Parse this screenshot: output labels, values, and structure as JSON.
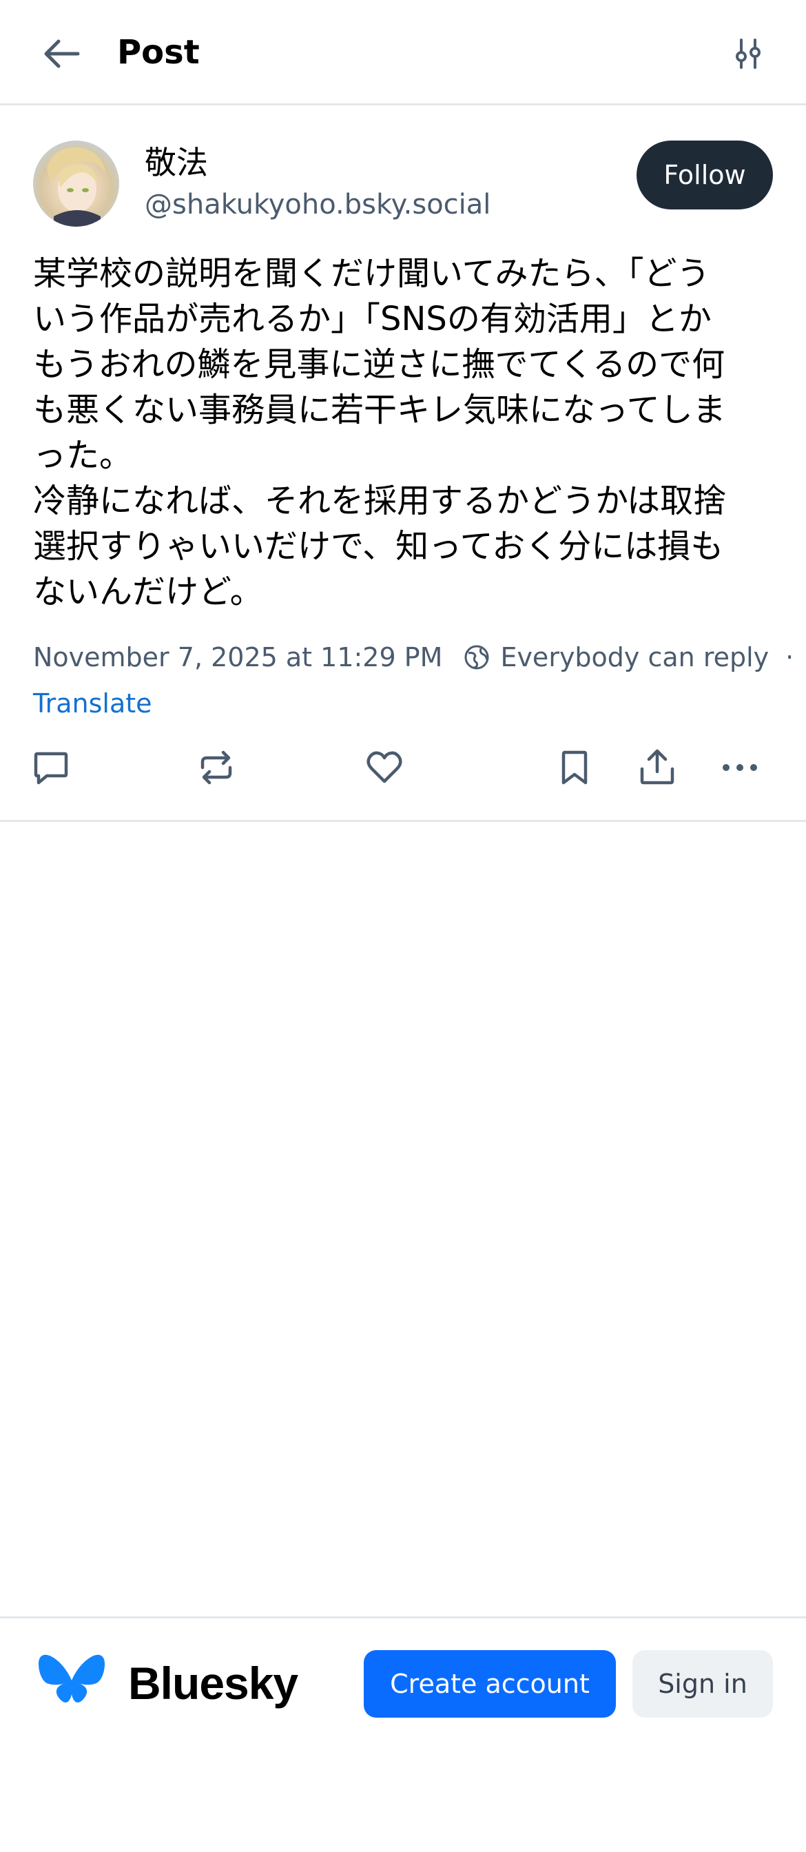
{
  "header": {
    "title": "Post"
  },
  "post": {
    "author": {
      "display_name": "敬法",
      "handle": "@shakukyoho.bsky.social"
    },
    "follow_label": "Follow",
    "text": "某学校の説明を聞くだけ聞いてみたら、「どう\nいう作品が売れるか」「SNSの有効活用」とか\nもうおれの鱗を見事に逆さに撫でてくるので何\nも悪くない事務員に若干キレ気味になってしま\nった。\n冷静になれば、それを採用するかどうかは取捨\n選択すりゃいいだけで、知っておく分には損も\nないんだけど。",
    "timestamp": "November 7, 2025 at 11:29 PM",
    "reply_setting": "Everybody can reply",
    "separator": "·",
    "translate_label": "Translate"
  },
  "actions": {
    "reply_icon": "reply-icon",
    "repost_icon": "repost-icon",
    "like_icon": "heart-icon",
    "bookmark_icon": "bookmark-icon",
    "share_icon": "share-icon",
    "more_icon": "more-icon"
  },
  "footer": {
    "brand": "Bluesky",
    "create_account_label": "Create account",
    "sign_in_label": "Sign in"
  },
  "colors": {
    "accent": "#0a6cff",
    "link": "#1370d0",
    "follow_bg": "#1f2a37",
    "muted_text": "#4b5b6e",
    "divider": "#e3e7ec"
  }
}
